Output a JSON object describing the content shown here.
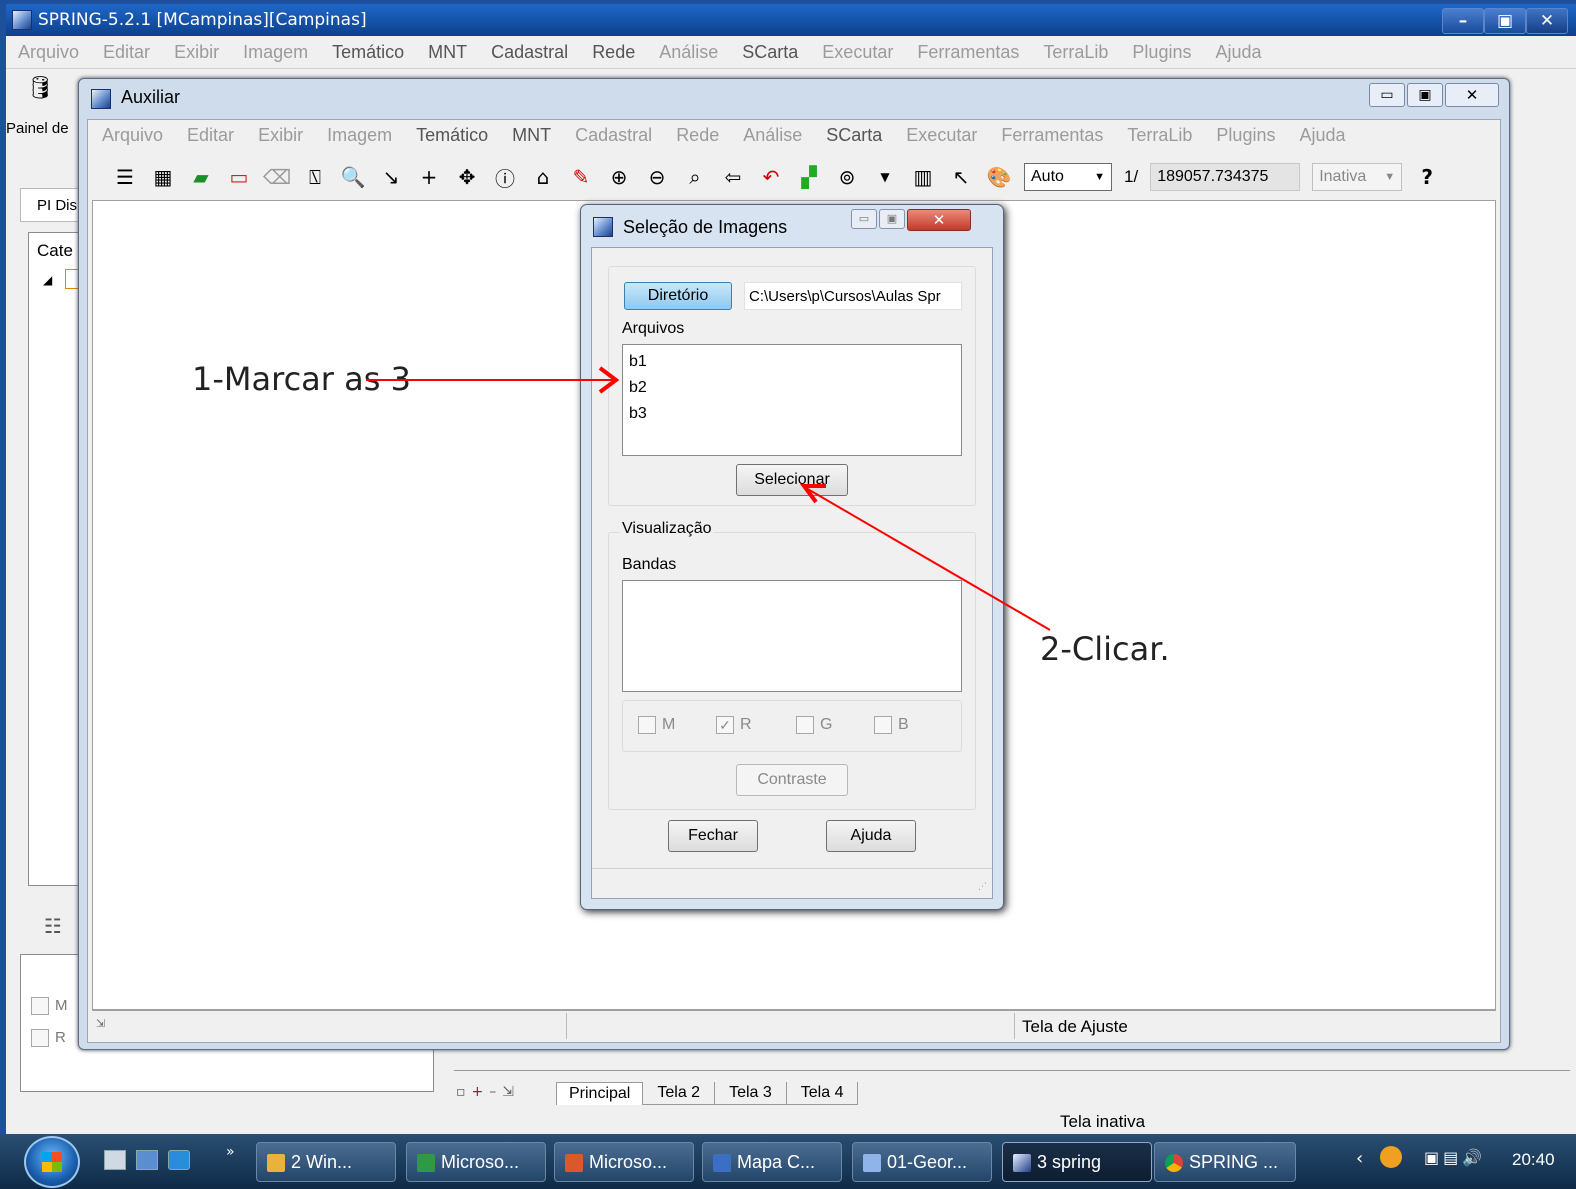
{
  "main_window": {
    "title": "SPRING-5.2.1 [MCampinas][Campinas]",
    "controls": [
      "–",
      "▣",
      "✕"
    ],
    "menu": [
      "Arquivo",
      "Editar",
      "Exibir",
      "Imagem",
      "Temático",
      "MNT",
      "Cadastral",
      "Rede",
      "Análise",
      "SCarta",
      "Executar",
      "Ferramentas",
      "TerraLib",
      "Plugins",
      "Ajuda"
    ],
    "painel_label": "Painel de",
    "panel_tab": "PI Dis",
    "panel_header": "Cate",
    "panel_checks": [
      "M",
      "R"
    ],
    "screen_tabs": [
      "Principal",
      "Tela 2",
      "Tela 3",
      "Tela 4"
    ],
    "status": "Tela inativa"
  },
  "aux_window": {
    "title": "Auxiliar",
    "menu": [
      "Arquivo",
      "Editar",
      "Exibir",
      "Imagem",
      "Temático",
      "MNT",
      "Cadastral",
      "Rede",
      "Análise",
      "SCarta",
      "Executar",
      "Ferramentas",
      "TerraLib",
      "Plugins",
      "Ajuda"
    ],
    "scale_mode": "Auto",
    "scale_prefix": "1/",
    "scale_value": "189057.734375",
    "inactive_select": "Inativa",
    "status": "Tela de Ajuste"
  },
  "dialog": {
    "title": "Seleção de Imagens",
    "directory_button": "Diretório",
    "directory_path": "C:\\Users\\p\\Cursos\\Aulas Spr",
    "files_label": "Arquivos",
    "files": [
      "b1",
      "b2",
      "b3"
    ],
    "select_button": "Selecionar",
    "visualization_label": "Visualização",
    "bands_label": "Bandas",
    "channels": [
      {
        "label": "M",
        "checked": false
      },
      {
        "label": "R",
        "checked": true
      },
      {
        "label": "G",
        "checked": false
      },
      {
        "label": "B",
        "checked": false
      }
    ],
    "contrast_button": "Contraste",
    "close_button": "Fechar",
    "help_button": "Ajuda"
  },
  "annotations": {
    "step1": "1-Marcar as 3",
    "step2": "2-Clicar.",
    "arrow_color": "#ff0000"
  },
  "taskbar": {
    "items": [
      "2 Win...",
      "Microso...",
      "Microso...",
      "Mapa C...",
      "01-Geor...",
      "3 spring",
      "SPRING ..."
    ],
    "clock": "20:40"
  }
}
